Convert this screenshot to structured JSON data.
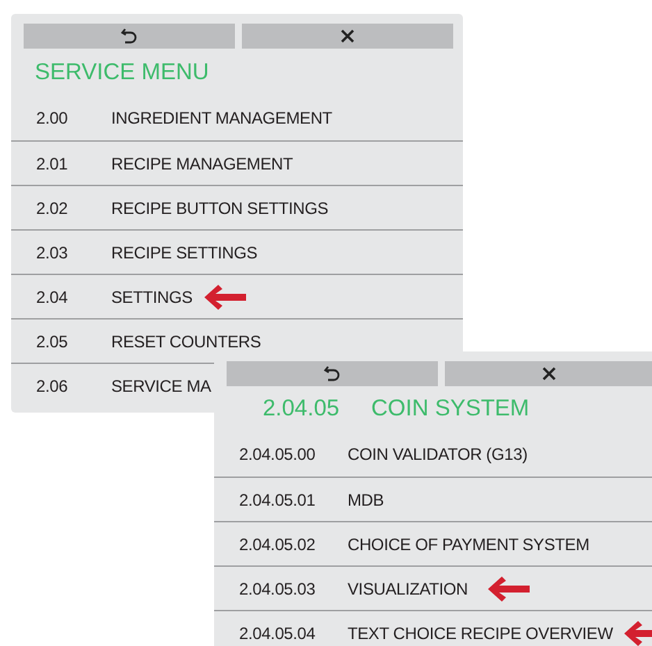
{
  "panels": [
    {
      "toolbar": [
        {
          "kind": "back"
        },
        {
          "kind": "close"
        }
      ],
      "title": "SERVICE MENU",
      "rows": [
        {
          "number": "2.00",
          "label": "INGREDIENT MANAGEMENT",
          "pointer": false
        },
        {
          "number": "2.01",
          "label": "RECIPE MANAGEMENT",
          "pointer": false
        },
        {
          "number": "2.02",
          "label": "RECIPE BUTTON SETTINGS",
          "pointer": false
        },
        {
          "number": "2.03",
          "label": "RECIPE SETTINGS",
          "pointer": false
        },
        {
          "number": "2.04",
          "label": "SETTINGS",
          "pointer": true
        },
        {
          "number": "2.05",
          "label": "RESET COUNTERS",
          "pointer": false
        },
        {
          "number": "2.06",
          "label": "SERVICE MA",
          "pointer": false
        }
      ]
    },
    {
      "toolbar": [
        {
          "kind": "back"
        },
        {
          "kind": "close"
        }
      ],
      "title_number": "2.04.05",
      "title": "COIN SYSTEM",
      "rows": [
        {
          "number": "2.04.05.00",
          "label": "COIN VALIDATOR (G13)",
          "pointer": false
        },
        {
          "number": "2.04.05.01",
          "label": "MDB",
          "pointer": false
        },
        {
          "number": "2.04.05.02",
          "label": "CHOICE OF PAYMENT SYSTEM",
          "pointer": false
        },
        {
          "number": "2.04.05.03",
          "label": "VISUALIZATION",
          "pointer": true
        },
        {
          "number": "2.04.05.04",
          "label": "TEXT CHOICE RECIPE OVERVIEW",
          "pointer": true
        }
      ]
    }
  ]
}
